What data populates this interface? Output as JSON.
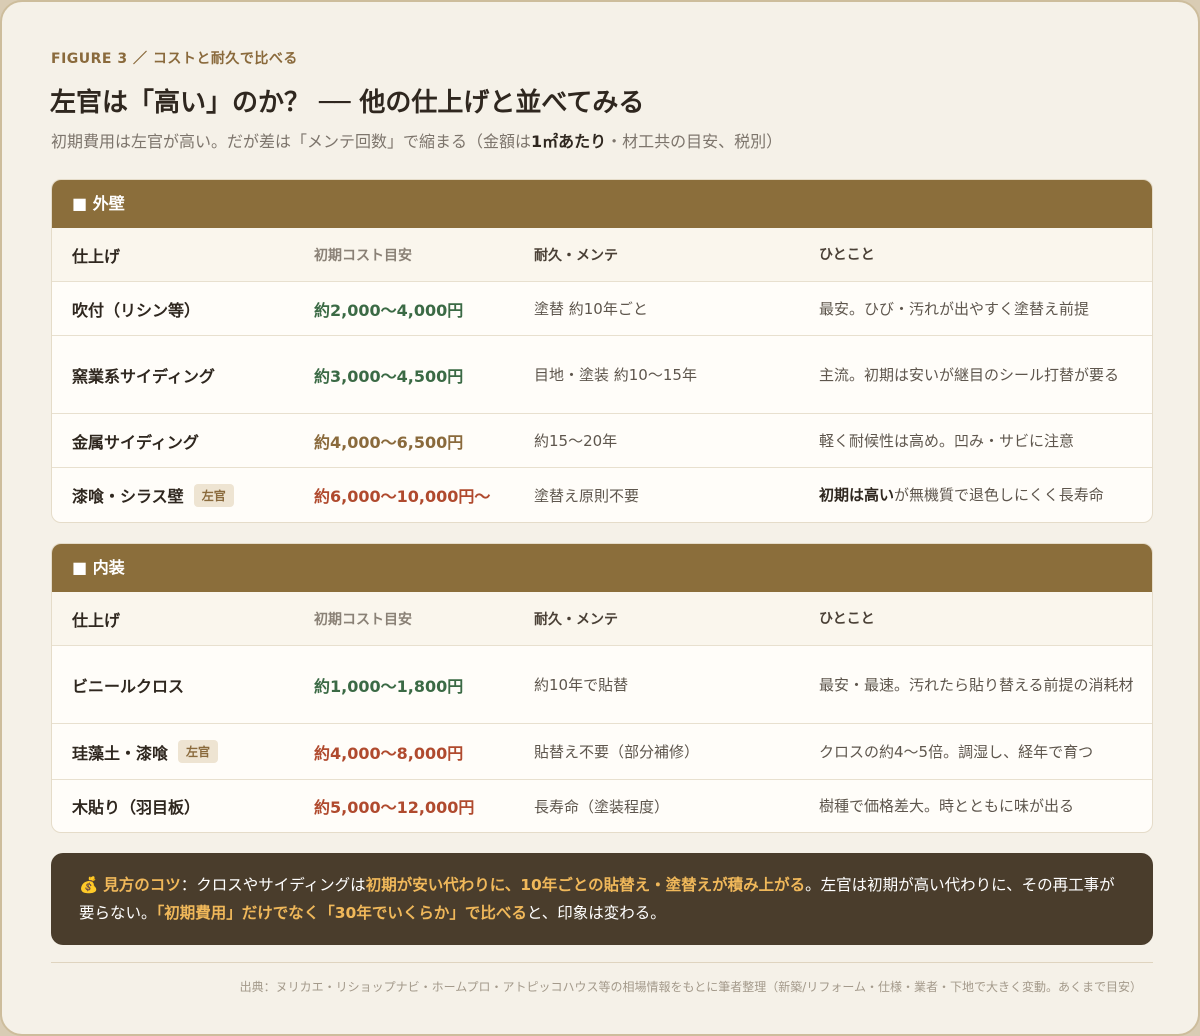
{
  "kicker": "FIGURE 3 ／ コストと耐久で比べる",
  "title": "左官は「高い」のか？ ── 他の仕上げと並べてみる",
  "subtitle_pre": "初期費用は左官が高い。だが差は「メンテ回数」で縮まる（金額は",
  "subtitle_bold": "1㎡あたり",
  "subtitle_post": "・材工共の目安、税別）",
  "columns": {
    "finish": "仕上げ",
    "cost": "初期コスト目安",
    "durability": "耐久・メンテ",
    "note": "ひとこと"
  },
  "sections": [
    {
      "heading": "■ 外壁",
      "rows": [
        {
          "finish": "吹付（リシン等）",
          "tag": "",
          "cost": "約2,000〜4,000円",
          "cost_color": "green",
          "durability": "塗替 約10年ごと",
          "note_bold": "",
          "note": "最安。ひび・汚れが出やすく塗替え前提"
        },
        {
          "finish": "窯業系サイディング",
          "tag": "",
          "cost": "約3,000〜4,500円",
          "cost_color": "green",
          "durability": "目地・塗装 約10〜15年",
          "note_bold": "",
          "note": "主流。初期は安いが継目のシール打替が要る"
        },
        {
          "finish": "金属サイディング",
          "tag": "",
          "cost": "約4,000〜6,500円",
          "cost_color": "brown",
          "durability": "約15〜20年",
          "note_bold": "",
          "note": "軽く耐候性は高め。凹み・サビに注意"
        },
        {
          "finish": "漆喰・シラス壁",
          "tag": "左官",
          "cost": "約6,000〜10,000円〜",
          "cost_color": "red",
          "durability": "塗替え原則不要",
          "note_bold": "初期は高い",
          "note": "が無機質で退色しにくく長寿命"
        }
      ]
    },
    {
      "heading": "■ 内装",
      "rows": [
        {
          "finish": "ビニールクロス",
          "tag": "",
          "cost": "約1,000〜1,800円",
          "cost_color": "green",
          "durability": "約10年で貼替",
          "note_bold": "",
          "note": "最安・最速。汚れたら貼り替える前提の消耗材"
        },
        {
          "finish": "珪藻土・漆喰",
          "tag": "左官",
          "cost": "約4,000〜8,000円",
          "cost_color": "red",
          "durability": "貼替え不要（部分補修）",
          "note_bold": "",
          "note": "クロスの約4〜5倍。調湿し、経年で育つ"
        },
        {
          "finish": "木貼り（羽目板）",
          "tag": "",
          "cost": "約5,000〜12,000円",
          "cost_color": "red",
          "durability": "長寿命（塗装程度）",
          "note_bold": "",
          "note": "樹種で価格差大。時とともに味が出る"
        }
      ]
    }
  ],
  "tip": {
    "icon": "💰",
    "label": "見方のコツ",
    "t1": "：クロスやサイディングは",
    "h1": "初期が安い代わりに、10年ごとの貼替え・塗替えが積み上がる",
    "t2": "。左官は初期が高い代わりに、その再工事が要らない。",
    "h2": "「初期費用」だけでなく「30年でいくらか」で比べる",
    "t3": "と、印象は変わる。"
  },
  "source": "出典：ヌリカエ・リショップナビ・ホームプロ・アトピッコハウス等の相場情報をもとに筆者整理（新築/リフォーム・仕様・業者・下地で大きく変動。あくまで目安）"
}
